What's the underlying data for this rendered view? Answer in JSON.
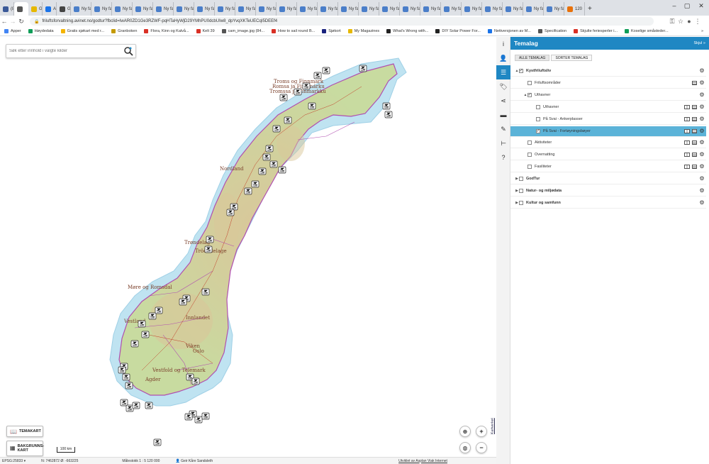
{
  "browser": {
    "tabs": [
      {
        "label": "(8)",
        "color": "#3b5998"
      },
      {
        "label": "",
        "color": "#555555",
        "active": true
      },
      {
        "label": "Guli",
        "color": "#e6b800"
      },
      {
        "label": "Avai",
        "color": "#1a73e8"
      },
      {
        "label": "Goo",
        "color": "#444444"
      },
      {
        "label": "Ny fane"
      },
      {
        "label": "Ny fane"
      },
      {
        "label": "Ny fane"
      },
      {
        "label": "Ny fane"
      },
      {
        "label": "Ny fane"
      },
      {
        "label": "Ny fane"
      },
      {
        "label": "Ny fane"
      },
      {
        "label": "Ny fane"
      },
      {
        "label": "Ny fane"
      },
      {
        "label": "Ny fane"
      },
      {
        "label": "Ny fane"
      },
      {
        "label": "Ny fane"
      },
      {
        "label": "Ny fane"
      },
      {
        "label": "Ny fane"
      },
      {
        "label": "Ny fane"
      },
      {
        "label": "Ny fane"
      },
      {
        "label": "Ny fane"
      },
      {
        "label": "Ny fane"
      },
      {
        "label": "Ny fane"
      },
      {
        "label": "Ny fane"
      },
      {
        "label": "Ny fane"
      },
      {
        "label": "Ny fane"
      },
      {
        "label": "Ny fane"
      },
      {
        "label": "Ny fane"
      },
      {
        "label": "120",
        "color": "#e8710a"
      }
    ],
    "new_tab": "+",
    "url": "friluftsforvaltning.avinet.no/godtur?fbclid=IwAR0ZD1Ge3RZWF-pqHTaHyWjD29YMhPU0dcbUIw8_dpYvqXKTeUECqI5DEEf4",
    "bookmarks": [
      {
        "label": "Apper",
        "color": "#4285f4"
      },
      {
        "label": "Høydedata",
        "color": "#0f9d58"
      },
      {
        "label": "Gratis sjøkart med r...",
        "color": "#f4b400"
      },
      {
        "label": "Granboken",
        "color": "#c49a00"
      },
      {
        "label": "Flora, Kinn og Kalvå...",
        "color": "#d93025"
      },
      {
        "label": "Kelt 39",
        "color": "#d93025"
      },
      {
        "label": "cam_image.jpg (84...",
        "color": "#555555"
      },
      {
        "label": "How to sail round B...",
        "color": "#d93025"
      },
      {
        "label": "Sjøkort",
        "color": "#1a237e"
      },
      {
        "label": "My Magazines",
        "color": "#e6b800"
      },
      {
        "label": "What's Wrong with...",
        "color": "#222222"
      },
      {
        "label": "DIY Solar Power For...",
        "color": "#222222"
      },
      {
        "label": "Nettversjonen av M...",
        "color": "#1a73e8"
      },
      {
        "label": "Specification",
        "color": "#555555"
      },
      {
        "label": "Skjulte feriesperler i...",
        "color": "#d93025"
      },
      {
        "label": "Koselige småsteder...",
        "color": "#0f9d58"
      }
    ],
    "more_bookmarks": "»"
  },
  "map": {
    "search_placeholder": "Søk etter innhold i valgte kilder",
    "labels": [
      "Troms og Finnmark",
      "Romsa ja Finnmárku",
      "Tromssa ja Finmarkku",
      "Nordland",
      "Trøndelag",
      "Trööndelage",
      "Møre og Romsdal",
      "Vestland",
      "Innlandet",
      "Viken",
      "Oslo",
      "Vestfold og Telemark",
      "Agder"
    ],
    "themes_button": "TEMAKART",
    "basemap_button": "BAKGRUNNS-\nKART",
    "scale_label": "100 km",
    "zoom_in": "+",
    "zoom_out": "−",
    "attribution": "Kartverket",
    "colors": {
      "land": "#c8dba0",
      "mountain": "#d9c79a",
      "water": "#bfe3f1",
      "border": "#b04fb0"
    }
  },
  "status": {
    "projection": "EPSG:25833",
    "coords": "N: 7462872 Ø: -663225",
    "scale": "Målestokk 1 : 5 120 000",
    "user": "Geir Kåre Sandsleth",
    "developer": "Utviklet av Asplan Viak Internet"
  },
  "panel": {
    "title": "Temalag",
    "close": "Skjul »",
    "tabs": [
      "ALLE TEMALAG",
      "SORTER TEMALAG"
    ],
    "rows": [
      {
        "label": "Kystfriluftsliv",
        "level": 0,
        "expand": "▲",
        "checked": true,
        "bold": true,
        "icons": [
          "gear"
        ]
      },
      {
        "label": "Friluftsområder",
        "level": 1,
        "checked": false,
        "icons": [
          "table",
          "gear"
        ]
      },
      {
        "label": "Uthavner",
        "level": 1,
        "expand": "▲",
        "checked": true,
        "icons": [
          "gear"
        ]
      },
      {
        "label": "Uthavner",
        "level": 2,
        "checked": false,
        "icons": [
          "hist",
          "table",
          "gear"
        ]
      },
      {
        "label": "På Svai - Ankerplasser",
        "level": 2,
        "checked": false,
        "icons": [
          "hist",
          "table",
          "gear"
        ]
      },
      {
        "label": "På Svai - Fortøyningsbøyer",
        "level": 2,
        "checked": true,
        "selected": true,
        "icons": [
          "hist",
          "table",
          "gear"
        ]
      },
      {
        "label": "Aktiviteter",
        "level": 1,
        "checked": false,
        "icons": [
          "hist",
          "table",
          "gear"
        ]
      },
      {
        "label": "Overnatting",
        "level": 1,
        "checked": false,
        "icons": [
          "hist",
          "table",
          "gear"
        ]
      },
      {
        "label": "Fasiliteter",
        "level": 1,
        "checked": false,
        "icons": [
          "hist",
          "table",
          "gear"
        ]
      },
      {
        "label": "GodTur",
        "level": 0,
        "expand": "▶",
        "checked": false,
        "bold": true,
        "icons": [
          "gear"
        ]
      },
      {
        "label": "Natur- og miljødata",
        "level": 0,
        "expand": "▶",
        "checked": false,
        "bold": true,
        "icons": [
          "gear"
        ]
      },
      {
        "label": "Kultur og samfunn",
        "level": 0,
        "expand": "▶",
        "checked": false,
        "bold": true,
        "icons": [
          "gear"
        ]
      }
    ],
    "accent": "#1f87c3",
    "selected_color": "#5bb3d8"
  },
  "iconbar": [
    {
      "name": "info-icon",
      "glyph": "i"
    },
    {
      "name": "user-icon",
      "glyph": "👤"
    },
    {
      "name": "layers-icon",
      "glyph": "☰",
      "active": true
    },
    {
      "name": "tag-icon",
      "glyph": "🏷"
    },
    {
      "name": "share-icon",
      "glyph": "⋖"
    },
    {
      "name": "toolbox-icon",
      "glyph": "▬"
    },
    {
      "name": "pencil-icon",
      "glyph": "✎"
    },
    {
      "name": "measure-icon",
      "glyph": "⊢"
    },
    {
      "name": "help-icon",
      "glyph": "?"
    }
  ]
}
